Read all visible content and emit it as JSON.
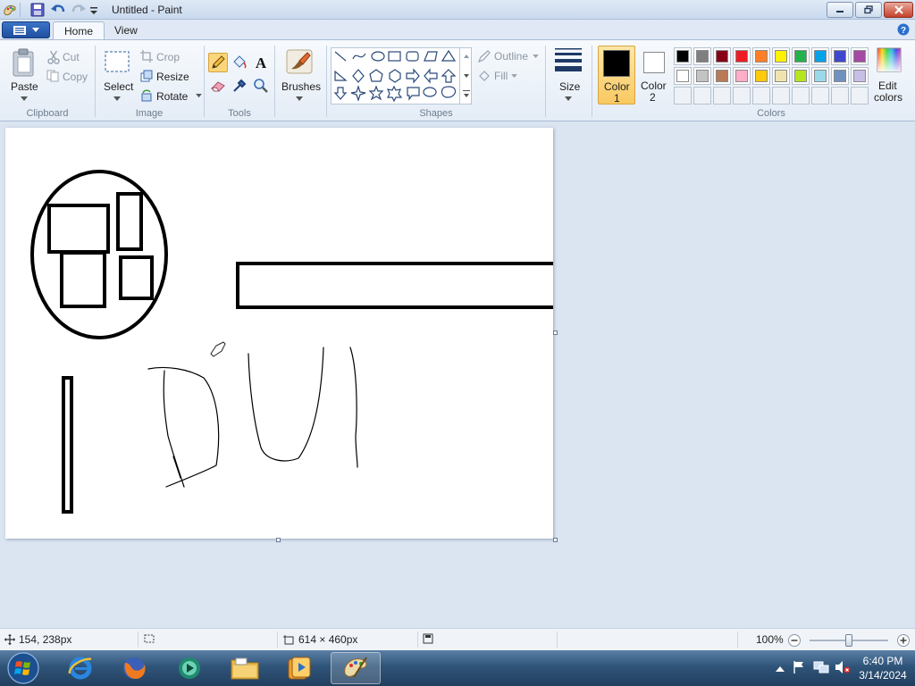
{
  "window": {
    "title": "Untitled - Paint",
    "quick_access": [
      "save-icon",
      "undo-icon",
      "redo-icon",
      "customize-icon"
    ],
    "controls": [
      "minimize",
      "restore",
      "close"
    ]
  },
  "ribbon": {
    "tabs": [
      {
        "label": "Home",
        "active": true
      },
      {
        "label": "View",
        "active": false
      }
    ],
    "clipboard": {
      "paste": "Paste",
      "cut": "Cut",
      "copy": "Copy",
      "group": "Clipboard"
    },
    "image": {
      "select": "Select",
      "crop": "Crop",
      "resize": "Resize",
      "rotate": "Rotate",
      "group": "Image"
    },
    "tools": {
      "group": "Tools",
      "items": [
        "pencil-icon",
        "fill-icon",
        "text-icon",
        "eraser-icon",
        "color-picker-icon",
        "magnifier-icon"
      ]
    },
    "brushes": {
      "label": "Brushes"
    },
    "shapes": {
      "group": "Shapes",
      "outline": "Outline",
      "fill": "Fill"
    },
    "size": {
      "label": "Size"
    },
    "color1": {
      "label": "Color",
      "num": "1",
      "value": "#000000"
    },
    "color2": {
      "label": "Color",
      "num": "2",
      "value": "#ffffff"
    },
    "colors": {
      "group": "Colors",
      "edit_label1": "Edit",
      "edit_label2": "colors",
      "palette_row1": [
        "#000000",
        "#7f7f7f",
        "#880015",
        "#ed1c24",
        "#ff7f27",
        "#fff200",
        "#22b14c",
        "#00a2e8",
        "#3f48cc",
        "#a349a4"
      ],
      "palette_row2": [
        "#ffffff",
        "#c3c3c3",
        "#b97a57",
        "#ffaec9",
        "#ffc90e",
        "#efe4b0",
        "#b5e61d",
        "#99d9ea",
        "#7092be",
        "#c8bfe7"
      ]
    }
  },
  "status": {
    "cursor": "154, 238px",
    "selection": "",
    "canvas_size": "614 × 460px",
    "file_size": "",
    "zoom": "100%",
    "zoom_level": 0.5
  },
  "taskbar": {
    "apps": [
      "start-orb",
      "internet-explorer",
      "firefox",
      "media-center",
      "file-explorer",
      "media-player",
      "paint"
    ],
    "time": "6:40 PM",
    "date": "3/14/2024"
  }
}
